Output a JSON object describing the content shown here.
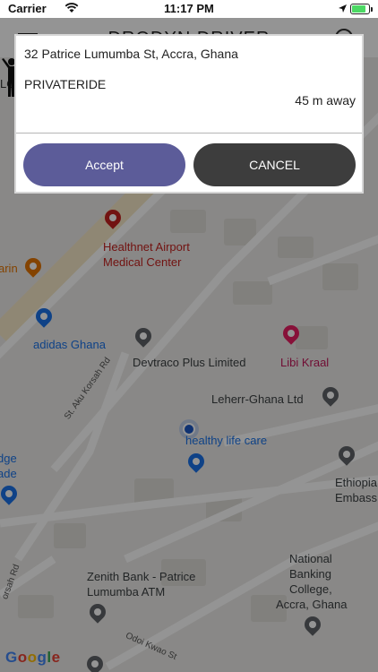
{
  "status_bar": {
    "carrier": "Carrier",
    "time": "11:17 PM",
    "battery_level": 0.85
  },
  "header": {
    "title": "DRODYN DRIVER",
    "menu_icon": "hamburger-icon",
    "right_icon": "timer-icon"
  },
  "map": {
    "pois": [
      {
        "name": "Healthnet Airport Medical Center",
        "line1": "Healthnet Airport",
        "line2": "Medical Center",
        "category": "health"
      },
      {
        "name": "adidas Ghana",
        "category": "shopping"
      },
      {
        "name": "Devtraco Plus Limited",
        "category": "place"
      },
      {
        "name": "Libi Kraal",
        "category": "lodging"
      },
      {
        "name": "Leherr-Ghana Ltd",
        "category": "place"
      },
      {
        "name": "healthy life care",
        "category": "shopping"
      },
      {
        "name": "Ethiopia Embassy",
        "line1": "Ethiopia",
        "line2": "Embass"
      },
      {
        "name": "National Banking College, Accra, Ghana",
        "line1": "National",
        "line2": "Banking",
        "line3": "College,",
        "line4": "Accra, Ghana"
      },
      {
        "name": "Zenith Bank - Patrice Lumumba ATM",
        "line1": "Zenith Bank - Patrice",
        "line2": "Lumumba ATM"
      },
      {
        "name": "arin",
        "category": "restaurant"
      },
      {
        "name": "dge ade",
        "line1": "dge",
        "line2": "ade"
      }
    ],
    "roads": [
      "St. Aku Korsah Rd",
      "Odoi Kwao St",
      "orsah Rd",
      "LO"
    ],
    "attribution": "Google"
  },
  "dialog": {
    "address": "32 Patrice Lumumba St, Accra, Ghana",
    "ride_type": "PRIVATERIDE",
    "distance": "45 m away",
    "accept_label": "Accept",
    "cancel_label": "CANCEL",
    "accept_color": "#5c5c99",
    "cancel_color": "#3d3d3d"
  }
}
